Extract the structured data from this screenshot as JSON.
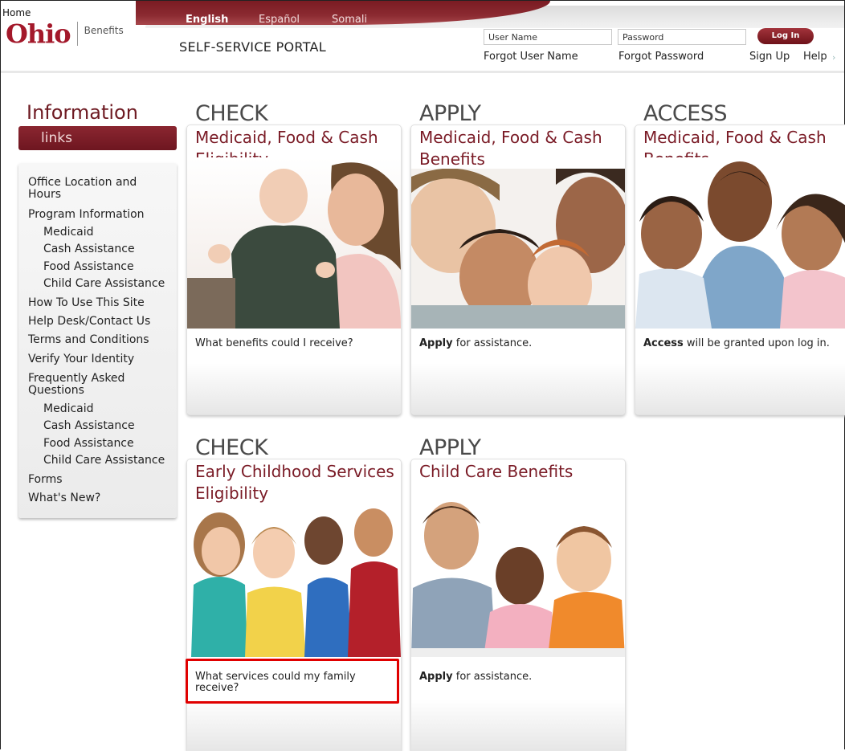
{
  "header": {
    "home_link": "Home",
    "logo_main": "Ohio",
    "logo_sub": "Benefits",
    "languages": [
      "English",
      "Español",
      "Somali"
    ],
    "portal_title": "SELF-SERVICE PORTAL",
    "username_placeholder": "User Name",
    "password_placeholder": "Password",
    "login_label": "Log In",
    "forgot_username": "Forgot User Name",
    "forgot_password": "Forgot Password",
    "sign_up": "Sign Up",
    "help": "Help"
  },
  "sidebar": {
    "title": "Information",
    "links_label": "links",
    "items": [
      {
        "label": "Office Location and Hours",
        "indent": false
      },
      {
        "label": "Program Information",
        "indent": false
      },
      {
        "label": "Medicaid",
        "indent": true
      },
      {
        "label": "Cash Assistance",
        "indent": true
      },
      {
        "label": "Food Assistance",
        "indent": true
      },
      {
        "label": "Child Care Assistance",
        "indent": true
      },
      {
        "label": "How To Use This Site",
        "indent": false
      },
      {
        "label": "Help Desk/Contact Us",
        "indent": false
      },
      {
        "label": "Terms and Conditions",
        "indent": false
      },
      {
        "label": "Verify Your Identity",
        "indent": false
      },
      {
        "label": "Frequently Asked Questions",
        "indent": false
      },
      {
        "label": "Medicaid",
        "indent": true
      },
      {
        "label": "Cash Assistance",
        "indent": true
      },
      {
        "label": "Food Assistance",
        "indent": true
      },
      {
        "label": "Child Care Assistance",
        "indent": true
      },
      {
        "label": "Forms",
        "indent": false
      },
      {
        "label": "What's New?",
        "indent": false
      }
    ]
  },
  "cards": [
    {
      "heading": "CHECK",
      "subheading": "Medicaid, Food & Cash Eligibility",
      "desc_bold": "",
      "desc": "What benefits could I receive?"
    },
    {
      "heading": "APPLY",
      "subheading": "Medicaid, Food & Cash Benefits",
      "desc_bold": "Apply",
      "desc": " for assistance."
    },
    {
      "heading": "ACCESS",
      "subheading": "Medicaid, Food & Cash Benefits",
      "desc_bold": "Access",
      "desc": " will be granted upon log in."
    },
    {
      "heading": "CHECK",
      "subheading": "Early Childhood Services Eligibility",
      "desc_bold": "",
      "desc": "What services could my family receive?"
    },
    {
      "heading": "APPLY",
      "subheading": "Child Care Benefits",
      "desc_bold": "Apply",
      "desc": " for assistance."
    }
  ]
}
